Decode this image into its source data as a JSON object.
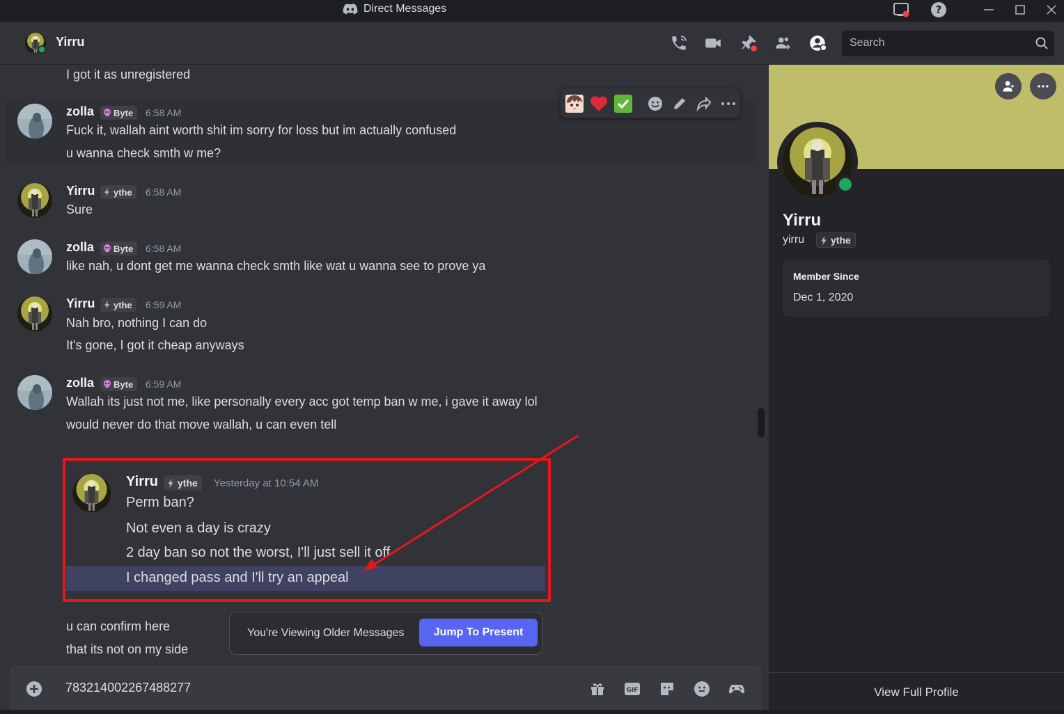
{
  "window": {
    "title": "Direct Messages"
  },
  "header": {
    "name": "Yirru",
    "search_placeholder": "Search"
  },
  "messages": {
    "m0_text": "I got it as unregistered",
    "g1": {
      "user": "zolla",
      "tag": "Byte",
      "time": "6:58 AM",
      "lines": [
        "Fuck it, wallah aint worth shit im sorry for loss but im actually confused",
        "u wanna check smth w me?"
      ]
    },
    "g2": {
      "user": "Yirru",
      "tag": "ythe",
      "time": "6:58 AM",
      "lines": [
        "Sure"
      ]
    },
    "g3": {
      "user": "zolla",
      "tag": "Byte",
      "time": "6:58 AM",
      "lines": [
        "like nah, u dont get me wanna check smth like wat u wanna see to prove ya"
      ]
    },
    "g4": {
      "user": "Yirru",
      "tag": "ythe",
      "time": "6:59 AM",
      "lines": [
        "Nah bro, nothing I can do",
        "It's gone, I got it cheap anyways"
      ]
    },
    "g5": {
      "user": "zolla",
      "tag": "Byte",
      "time": "6:59 AM",
      "lines": [
        "Wallah its just not me, like personally every acc got temp ban w me, i gave it away lol",
        "would never do that move wallah, u can even tell"
      ]
    },
    "quoted": {
      "user": "Yirru",
      "tag": "ythe",
      "time": "Yesterday at 10:54 AM",
      "lines": [
        "Perm ban?",
        "Not even a day is crazy",
        "2 day ban so not the worst, I'll just sell it off",
        "I changed pass and I'll try an appeal"
      ]
    },
    "tail": [
      "u can confirm here",
      "that its not on my side"
    ]
  },
  "older_bar": {
    "label": "You're Viewing Older Messages",
    "button": "Jump To Present"
  },
  "composer": {
    "value": "783214002267488277",
    "gif_label": "GIF"
  },
  "profile": {
    "display_name": "Yirru",
    "username": "yirru",
    "tag": "ythe",
    "member_since_label": "Member Since",
    "member_since": "Dec 1, 2020",
    "view_full": "View Full Profile"
  },
  "colors": {
    "accent": "#5865f2",
    "banner": "#bfbd6a",
    "online": "#23a55a",
    "annotation": "#e8161c"
  }
}
